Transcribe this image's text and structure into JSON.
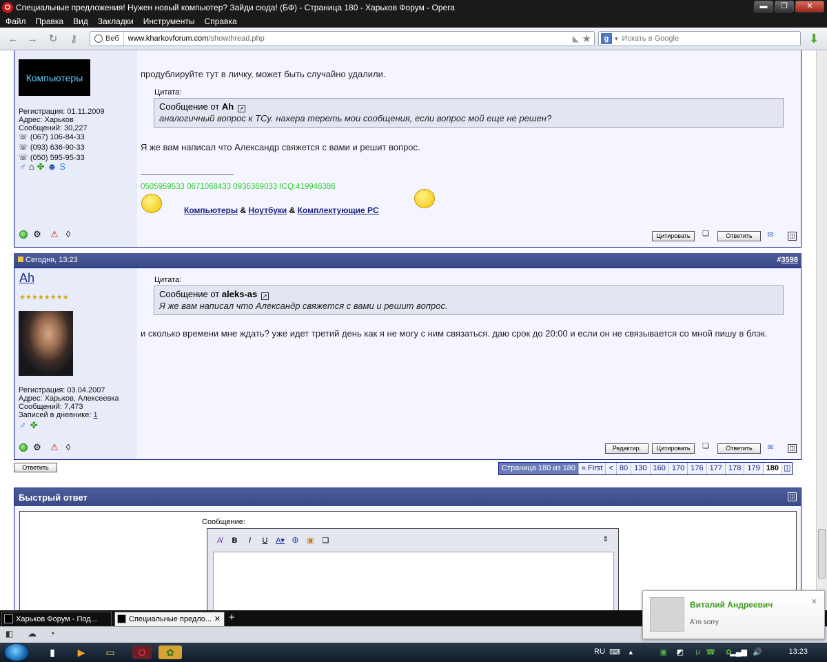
{
  "window": {
    "title": "Специальные предложения! Нужен новый компьютер? Зайди сюда! (БФ) - Страница 180 - Харьков Форум - Opera",
    "min": "▬",
    "max": "❐",
    "close": "✕"
  },
  "menu": [
    "Файл",
    "Правка",
    "Вид",
    "Закладки",
    "Инструменты",
    "Справка"
  ],
  "address": {
    "web_label": "Веб",
    "url_host": "www.kharkovforum.com",
    "url_path": "/showthread.php",
    "search_placeholder": "Искать в Google"
  },
  "post1": {
    "avatar_text": "Компьютеры",
    "stats": [
      "Регистрация: 01.11.2009",
      "Адрес: Харьков",
      "Сообщений: 30,227",
      "(067) 106-84-33",
      "(093) 636-90-33",
      "(050) 595-95-33"
    ],
    "text1": "продублируйте тут в личку, может быть случайно удалили.",
    "quote_label": "Цитата:",
    "quote_from_prefix": "Сообщение от",
    "quote_author": "Ah",
    "quote_text": "аналогичный вопрос к ТСу. нахера тереть мои сообщения, если вопрос мой еще не решен?",
    "text2": "Я же вам написал что Александр свяжется с вами и решит вопрос.",
    "sig_phones": "0505959533 0671068433 0936369033 ICQ:419946386",
    "sig_link1": "Компьютеры",
    "sig_amp1": "&",
    "sig_link2": "Ноутбуки",
    "sig_amp2": "&",
    "sig_link3": "Комплектующие PC",
    "btn_quote": "Цитировать",
    "btn_reply": "Ответить"
  },
  "post2": {
    "date": "Сегодня, 13:23",
    "postno_hash": "#",
    "postno": "3598",
    "username": "Ah",
    "stars": "★★★★★★★★",
    "stats": [
      "Регистрация: 03.04.2007",
      "Адрес: Харьков, Алексеевка",
      "Сообщений: 7,473"
    ],
    "diary_label": "Записей в дневнике:",
    "diary_count": "1",
    "quote_label": "Цитата:",
    "quote_from_prefix": "Сообщение от",
    "quote_author": "aleks-as",
    "quote_text": "Я же вам написал что Александр свяжется с вами и решит вопрос.",
    "text1": "и сколько времени мне ждать? уже идет третий день как я не могу с ним связаться. даю срок до 20:00 и если он не связывается со мной пишу в блэк.",
    "btn_edit": "Редактир.",
    "btn_quote": "Цитировать",
    "btn_reply": "Ответить"
  },
  "reply_below": "Ответить",
  "pager": {
    "info": "Страница 180 из 180",
    "first": "« First",
    "prev": "<",
    "pages": [
      "80",
      "130",
      "160",
      "170",
      "176",
      "177",
      "178",
      "179"
    ],
    "current": "180"
  },
  "quick_reply": {
    "title": "Быстрый ответ",
    "message_label": "Сообщение:"
  },
  "tabs": [
    {
      "label": "Харьков Форум - Под..."
    },
    {
      "label": "Специальные предло..."
    }
  ],
  "tab_add": "+",
  "notification": {
    "name": "Виталий Андреевич",
    "message": "A'm sorry"
  },
  "tray": {
    "lang": "RU",
    "time": "13:23"
  }
}
